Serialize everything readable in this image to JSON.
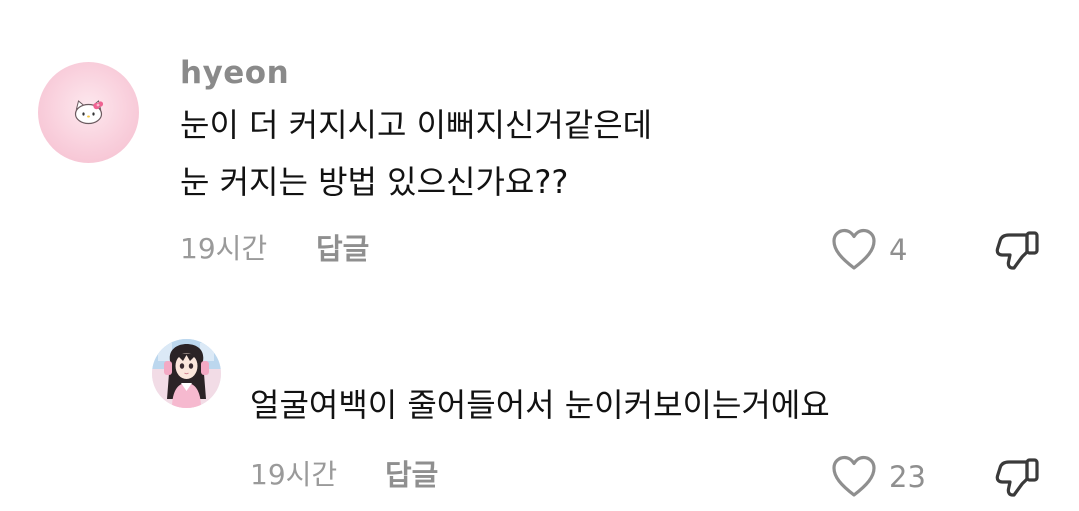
{
  "comments": [
    {
      "username": "hyeon",
      "lines": [
        "눈이 더 커지시고 이뻐지신거같은데",
        "눈 커지는 방법 있으신가요??"
      ],
      "time": "19시간",
      "reply_label": "답글",
      "likes": "4",
      "avatar_icon": "hello-kitty-icon"
    },
    {
      "username": "",
      "lines": [
        "얼굴여백이 줄어들어서 눈이커보이는거에요"
      ],
      "time": "19시간",
      "reply_label": "답글",
      "likes": "23",
      "avatar_icon": "anime-girl-avatar"
    }
  ],
  "colors": {
    "text": "#121212",
    "muted": "#9a9a9a",
    "avatar1_bg": "#f9cfdc"
  },
  "icons": {
    "like": "heart-outline-icon",
    "dislike": "thumbs-down-outline-icon"
  }
}
